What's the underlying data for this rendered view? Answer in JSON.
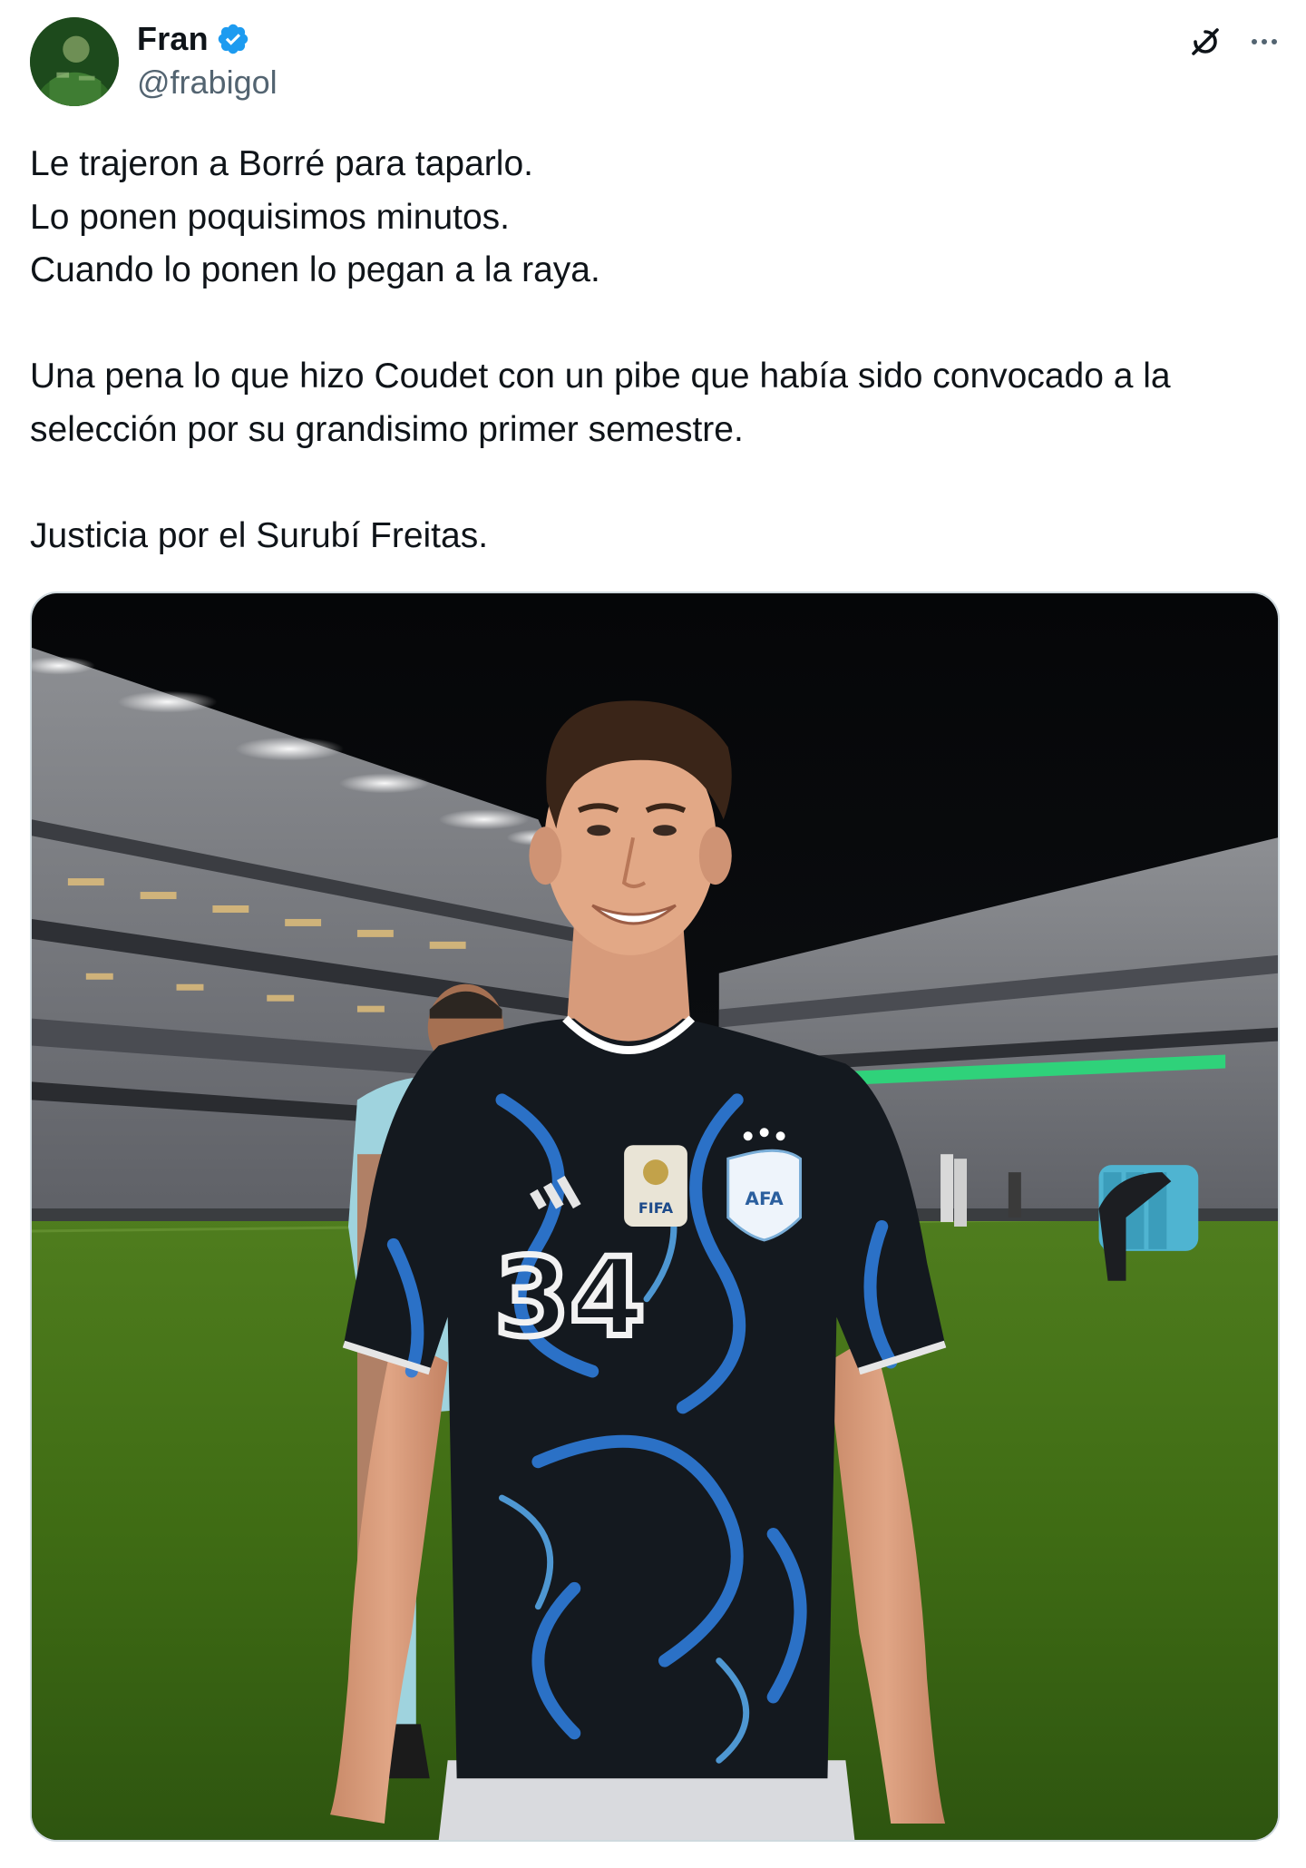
{
  "tweet": {
    "author": {
      "display_name": "Fran",
      "handle": "@frabigol",
      "verified_icon": "verified-badge-icon",
      "avatar": "profile-avatar"
    },
    "actions": {
      "grok_icon": "grok-icon",
      "more_icon": "more-options-icon"
    },
    "text": {
      "line1": "Le trajeron a Borré para taparlo.",
      "line2": "Lo ponen poquisimos minutos.",
      "line3": "Cuando lo ponen lo pegan a la raya.",
      "line4": "Una pena lo que hizo Coudet con un pibe que había sido convocado a la",
      "line5": "selección por su grandisimo primer semestre.",
      "line6": "Justicia por el Surubí Freitas."
    },
    "media": {
      "jersey_number": "34",
      "crest_text": "AFA",
      "patch_text": "FIFA"
    }
  },
  "colors": {
    "text": "#0f1419",
    "secondary_text": "#536471",
    "verified_blue": "#1d9bf0",
    "border": "#cfd9de"
  }
}
